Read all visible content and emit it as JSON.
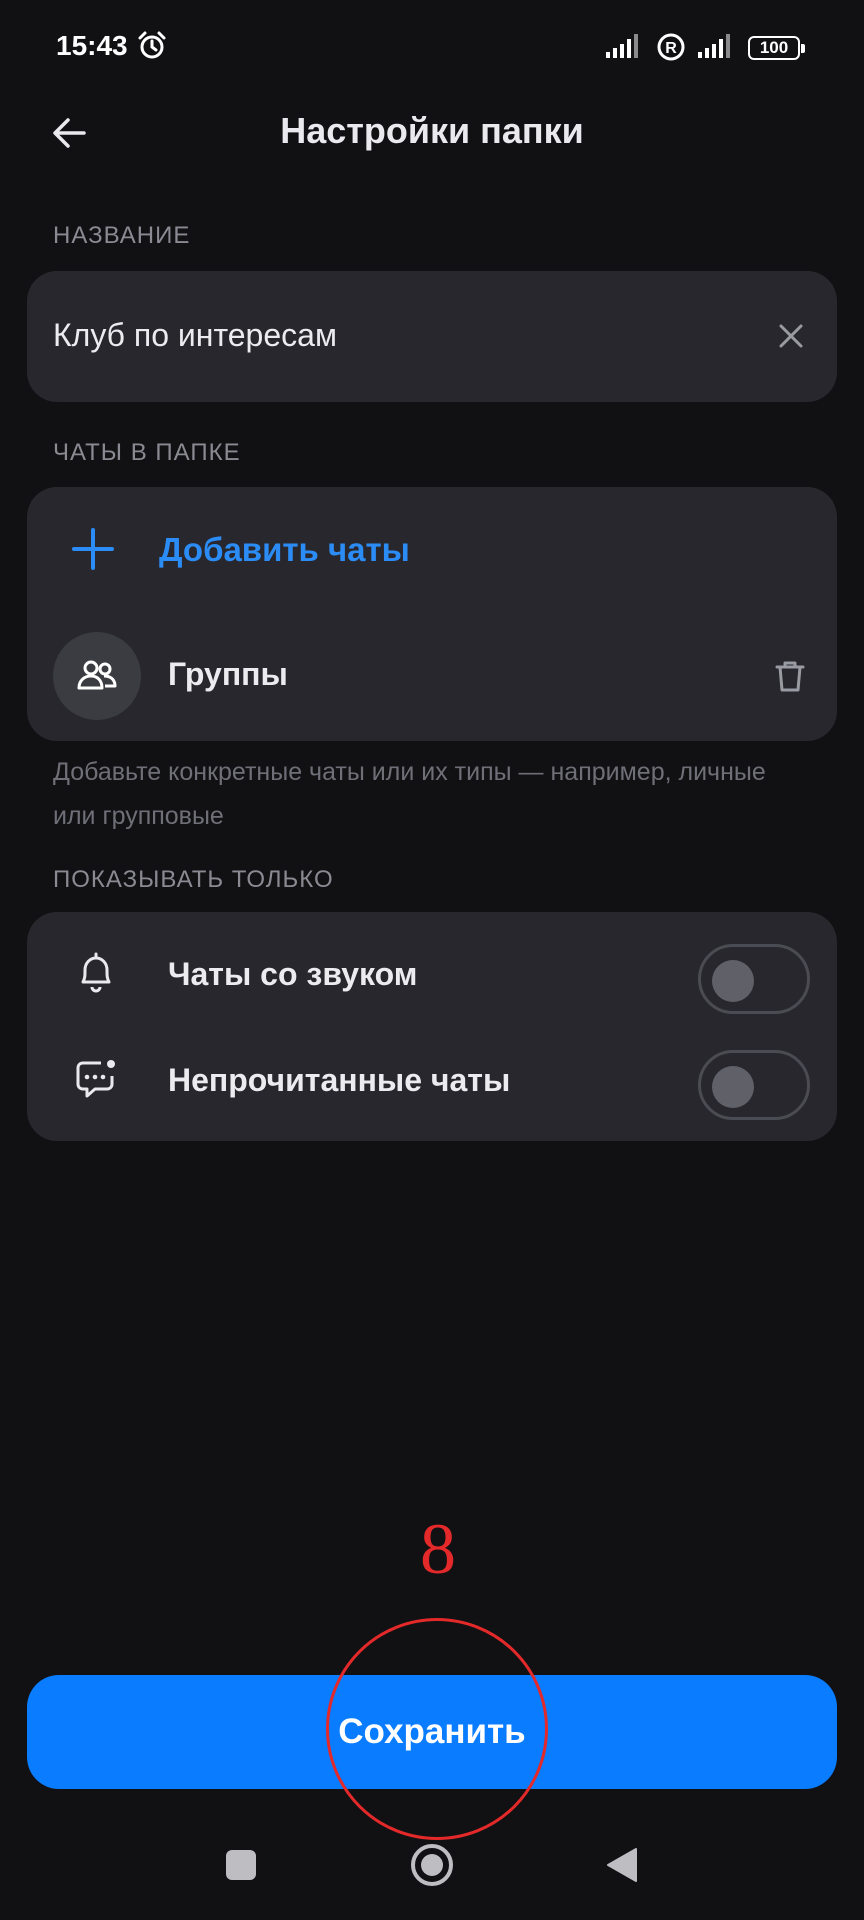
{
  "status_bar": {
    "time": "15:43",
    "battery": "100",
    "icons": [
      "alarm-icon",
      "signal-icon",
      "roaming-icon",
      "signal-icon"
    ]
  },
  "header": {
    "title": "Настройки папки",
    "back_icon": "arrow-left-icon"
  },
  "name_section": {
    "label": "НАЗВАНИЕ",
    "value": "Клуб по интересам",
    "clear_icon": "close-icon"
  },
  "chats_section": {
    "label": "ЧАТЫ В ПАПКЕ",
    "add_label": "Добавить чаты",
    "items": [
      {
        "label": "Группы",
        "icon": "people-icon",
        "action_icon": "trash-icon"
      }
    ],
    "hint": "Добавьте конкретные чаты или их типы — например, личные или групповые"
  },
  "filter_section": {
    "label": "ПОКАЗЫВАТЬ ТОЛЬКО",
    "toggles": [
      {
        "label": "Чаты со звуком",
        "icon": "bell-icon",
        "on": false
      },
      {
        "label": "Непрочитанные чаты",
        "icon": "unread-chat-icon",
        "on": false
      }
    ]
  },
  "save_button": {
    "label": "Сохранить"
  },
  "annotation": {
    "number": "8"
  },
  "colors": {
    "background": "#111113",
    "card": "#27272d",
    "accent": "#2c8cf5",
    "button": "#0a7cff",
    "annotation": "#e32929"
  }
}
